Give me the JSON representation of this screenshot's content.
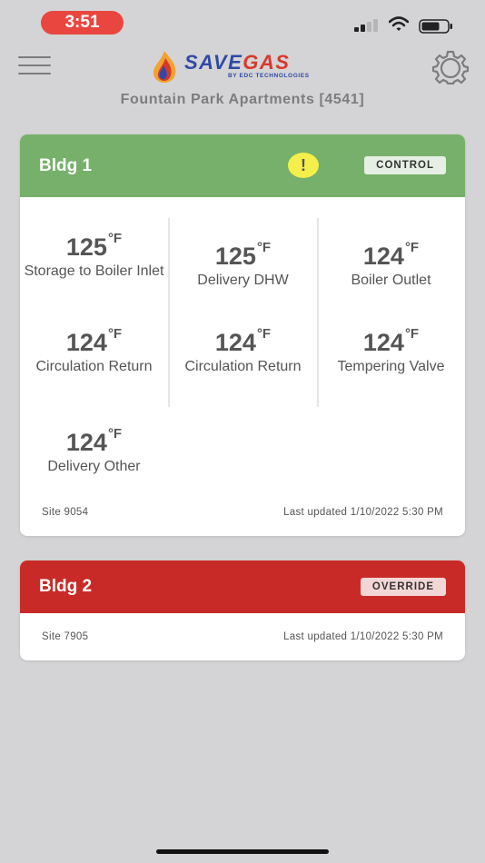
{
  "status": {
    "time": "3:51",
    "time_bg": "#e8463f"
  },
  "header": {
    "logo_save": "SAVE",
    "logo_gas": "GAS",
    "logo_sub": "BY EDC TECHNOLOGIES",
    "property": "Fountain Park Apartments [4541]"
  },
  "buildings": [
    {
      "name": "Bldg 1",
      "mode": "CONTROL",
      "header_color": "#76b06a",
      "alert": "!",
      "sensors": [
        {
          "temp": "125",
          "unit": "°F",
          "label": "Storage to Boiler Inlet"
        },
        {
          "temp": "125",
          "unit": "°F",
          "label": "Delivery DHW"
        },
        {
          "temp": "124",
          "unit": "°F",
          "label": "Boiler Outlet"
        },
        {
          "temp": "124",
          "unit": "°F",
          "label": "Circulation Return"
        },
        {
          "temp": "124",
          "unit": "°F",
          "label": "Circulation Return"
        },
        {
          "temp": "124",
          "unit": "°F",
          "label": "Tempering Valve"
        },
        {
          "temp": "124",
          "unit": "°F",
          "label": "Delivery Other"
        }
      ],
      "site": "Site 9054",
      "updated": "Last updated 1/10/2022 5:30 PM"
    },
    {
      "name": "Bldg 2",
      "mode": "OVERRIDE",
      "header_color": "#c82b27",
      "site": "Site 7905",
      "updated": "Last updated 1/10/2022 5:30 PM"
    }
  ]
}
